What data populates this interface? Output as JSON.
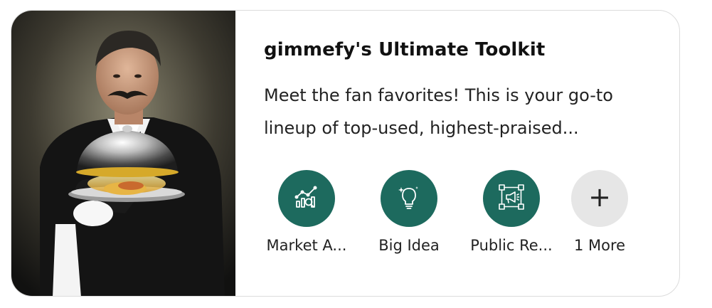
{
  "card": {
    "title": "gimmefy's Ultimate Toolkit",
    "description": "Meet the fan favorites! This is your go-to lineup of top-used, highest-praised..."
  },
  "hero": {
    "icon": "butler-with-serving-cloche-illustration"
  },
  "colors": {
    "tool_accent": "#1d6a5e",
    "more_bg": "#e6e6e6",
    "border": "#dcdcdc"
  },
  "tools": [
    {
      "label": "Market A...",
      "icon": "market-analysis-icon"
    },
    {
      "label": "Big Idea",
      "icon": "lightbulb-icon"
    },
    {
      "label": "Public Re...",
      "icon": "public-relations-icon"
    },
    {
      "label": "1 More",
      "icon": "plus-icon"
    }
  ],
  "more_glyph": "+"
}
